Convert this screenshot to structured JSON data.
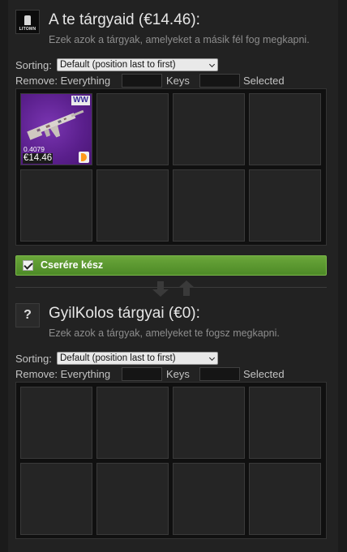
{
  "my_party": {
    "avatar_text": "LITOMN",
    "title": "A te tárgyaid (€14.46):",
    "subtitle": "Ezek azok a tárgyak, amelyeket a másik fél fog megkapni.",
    "sorting_label": "Sorting:",
    "sorting_value": "Default (position last to first)",
    "remove_label": "Remove: Everything",
    "keys_label": "Keys",
    "selected_label": "Selected",
    "item": {
      "badge": "WW",
      "float": "0.4079",
      "price": "€14.46"
    }
  },
  "ready": {
    "label": "Cserére kész",
    "checked": true,
    "color": "#5a9a2e"
  },
  "their_party": {
    "avatar_text": "?",
    "title": "GyilKolos tárgyai (€0):",
    "subtitle": "Ezek azok a tárgyak, amelyeket te fogsz megkapni.",
    "sorting_label": "Sorting:",
    "sorting_value": "Default (position last to first)",
    "remove_label": "Remove: Everything",
    "keys_label": "Keys",
    "selected_label": "Selected"
  },
  "icons": {
    "avatar_mine": "steam-avatar-icon",
    "avatar_other": "question-mark-icon",
    "exchange": "swap-arrows-icon",
    "ready_check": "checkbox-checked-icon",
    "sticker": "sticker-icon",
    "weapon": "ak47-rifle-icon"
  },
  "colors": {
    "background": "#1b1b1b",
    "panel": "#222222",
    "item_bg": "#5a1f8c",
    "ready_green": "#5a9a2e"
  }
}
